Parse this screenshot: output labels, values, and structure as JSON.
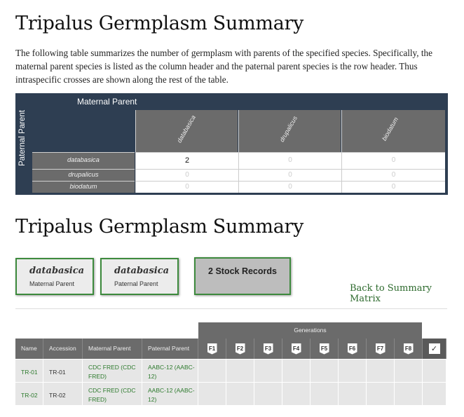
{
  "page": {
    "title1": "Tripalus Germplasm Summary",
    "intro": "The following table summarizes the number of germplasm with parents of the specified species. Specifically, the maternal parent species is listed as the column header and the paternal parent species is the row header. Thus intraspecific crosses are shown along the rest of the table.",
    "title2": "Tripalus Germplasm Summary"
  },
  "matrix": {
    "maternal_label": "Maternal Parent",
    "paternal_label": "Paternal Parent",
    "columns": [
      "databasica",
      "drupalicus",
      "biodatum"
    ],
    "rows": [
      {
        "label": "databasica",
        "values": [
          "2",
          "0",
          "0"
        ]
      },
      {
        "label": "drupalicus",
        "values": [
          "0",
          "0",
          "0"
        ]
      },
      {
        "label": "biodatum",
        "values": [
          "0",
          "0",
          "0"
        ]
      }
    ],
    "colors": {
      "header_bg": "#2e3e52",
      "cell_header_bg": "#6b6b6b"
    }
  },
  "cards": {
    "maternal": {
      "species": "databasica",
      "role": "Maternal Parent"
    },
    "paternal": {
      "species": "databasica",
      "role": "Paternal Parent"
    },
    "stock": "2 Stock Records",
    "back_link": "Back to Summary Matrix"
  },
  "stock_table": {
    "generations_label": "Generations",
    "headers": [
      "Name",
      "Accession",
      "Maternal Parent",
      "Paternal Parent"
    ],
    "generations": [
      "F1",
      "F2",
      "F3",
      "F4",
      "F5",
      "F6",
      "F7",
      "F8"
    ],
    "rows": [
      {
        "name": "TR-01",
        "accession": "TR-01",
        "maternal": "CDC FRED (CDC FRED)",
        "paternal": "AABC-12 (AABC-12)"
      },
      {
        "name": "TR-02",
        "accession": "TR-02",
        "maternal": "CDC FRED (CDC FRED)",
        "paternal": "AABC-12 (AABC-12)"
      }
    ],
    "colors": {
      "link": "#2d7a2d",
      "accent_border": "#3d8a3d"
    }
  }
}
